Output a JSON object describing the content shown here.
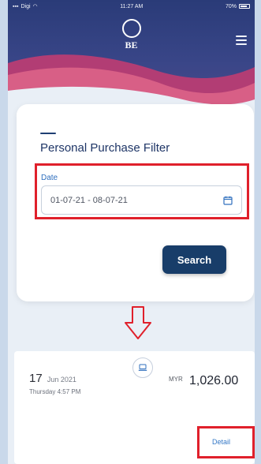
{
  "status_bar": {
    "carrier": "Digi",
    "time": "11:27 AM",
    "battery": "70%"
  },
  "header": {
    "logo_text": "BE",
    "icons": {
      "menu": "hamburger-menu-icon"
    }
  },
  "filter": {
    "title": "Personal Purchase Filter",
    "date_label": "Date",
    "date_value": "01-07-21 - 08-07-21",
    "search_label": "Search",
    "icons": {
      "calendar": "calendar-icon"
    }
  },
  "result": {
    "day": "17",
    "month_year": "Jun 2021",
    "weekday_time": "Thursday 4:57 PM",
    "currency": "MYR",
    "amount": "1,026.00",
    "detail_label": "Detail",
    "icons": {
      "device": "laptop-icon",
      "arrow": "arrow-down-icon"
    }
  },
  "colors": {
    "header_bg": "#2a3b78",
    "header_wave_pink": "#c94a7a",
    "primary_button": "#183d69",
    "highlight_border": "#e0202b",
    "link": "#3578c6",
    "title": "#1e3566"
  }
}
